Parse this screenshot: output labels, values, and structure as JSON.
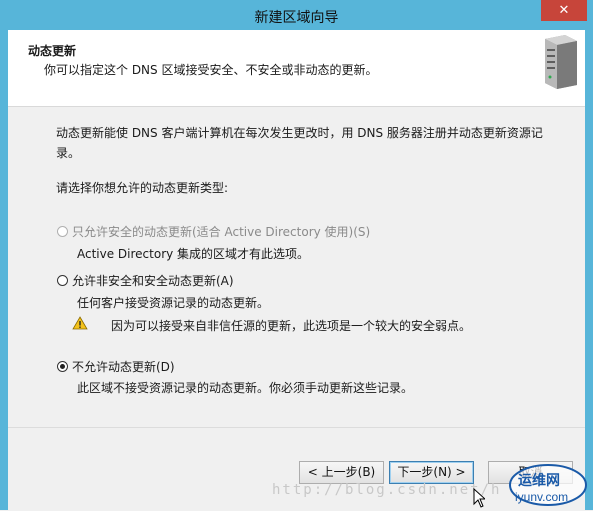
{
  "window": {
    "title": "新建区域向导",
    "close_label": "✕"
  },
  "header": {
    "title": "动态更新",
    "subtitle": "你可以指定这个 DNS 区域接受安全、不安全或非动态的更新。"
  },
  "body": {
    "description": "动态更新能使 DNS 客户端计算机在每次发生更改时，用 DNS 服务器注册并动态更新资源记录。",
    "prompt": "请选择你想允许的动态更新类型:",
    "options": [
      {
        "label": "只允许安全的动态更新(适合 Active Directory 使用)(S)",
        "note": "Active Directory 集成的区域才有此选项。",
        "checked": false,
        "enabled": false
      },
      {
        "label": "允许非安全和安全动态更新(A)",
        "note": "任何客户接受资源记录的动态更新。",
        "warning": "因为可以接受来自非信任源的更新，此选项是一个较大的安全弱点。",
        "checked": false,
        "enabled": true
      },
      {
        "label": "不允许动态更新(D)",
        "note": "此区域不接受资源记录的动态更新。你必须手动更新这些记录。",
        "checked": true,
        "enabled": true
      }
    ]
  },
  "footer": {
    "back_label": "< 上一步(B)",
    "next_label": "下一步(N) >",
    "cancel_label": "取消"
  },
  "overlay": {
    "watermark": "http://blog.csdn.net/h",
    "logo_text": "运维网",
    "logo_domain": "iyunv.com"
  },
  "colors": {
    "titlebar": "#57b5d9",
    "close": "#c7453a",
    "accent": "#3c7fb1"
  }
}
